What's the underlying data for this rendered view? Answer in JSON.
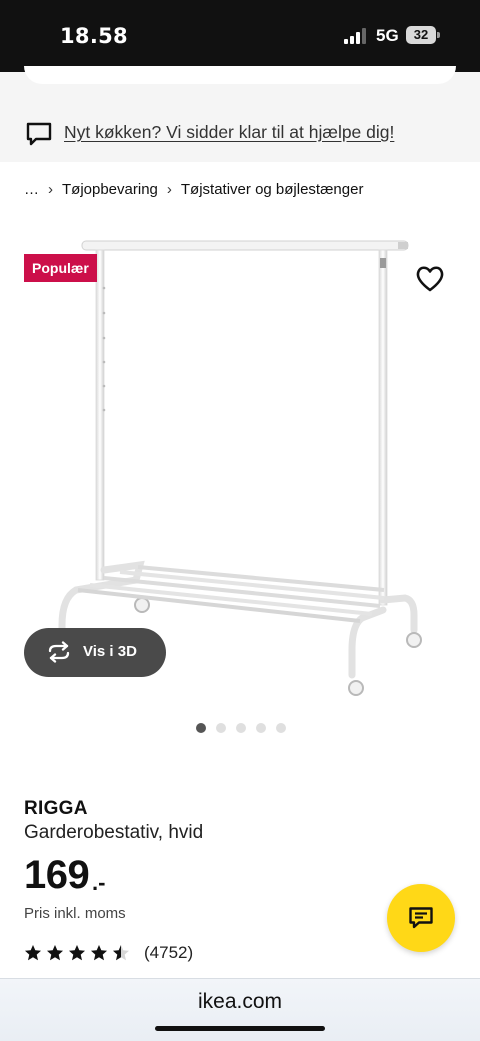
{
  "status": {
    "time": "18.58",
    "network": "5G",
    "battery": "32"
  },
  "help_banner": {
    "text": "Nyt køkken? Vi sidder klar til at hjælpe dig!",
    "icon": "chat-bubble-icon"
  },
  "breadcrumb": {
    "items": [
      "…",
      "Tøjopbevaring",
      "Tøjstativer og bøjlestænger"
    ]
  },
  "product": {
    "badge": "Populær",
    "view_3d_label": "Vis i 3D",
    "name": "RIGGA",
    "description": "Garderobestativ, hvid",
    "price_value": "169",
    "price_suffix": ".-",
    "price_note": "Pris inkl. moms",
    "rating": 4.5,
    "review_count": "(4752)",
    "image_count": 5,
    "active_image": 0
  },
  "browser": {
    "url": "ikea.com"
  },
  "colors": {
    "badge": "#cc0f4a",
    "chat_button": "#ffd817",
    "status_bar": "#111111",
    "view_3d_button": "#4a4a4a"
  }
}
